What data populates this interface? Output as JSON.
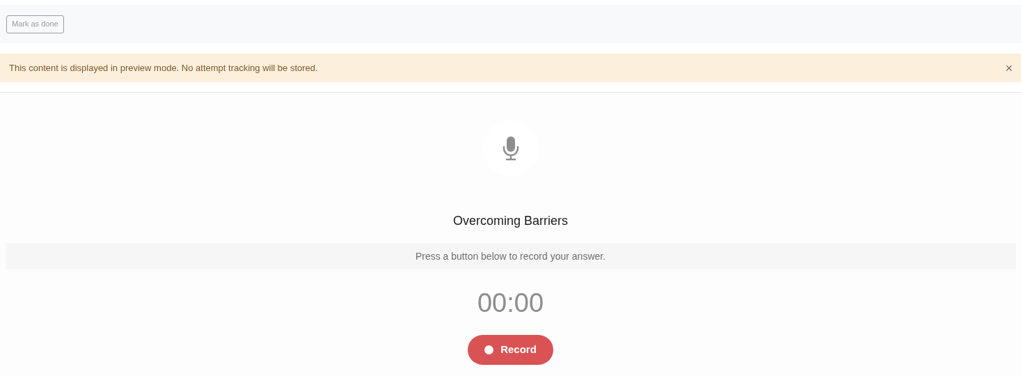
{
  "toolbar": {
    "button": "Mark as done"
  },
  "alert": {
    "message": "This content is displayed in preview mode. No attempt tracking will be stored.",
    "close": "×"
  },
  "recorder": {
    "title": "Overcoming Barriers",
    "instruction": "Press a button below to record your answer.",
    "timer": "00:00",
    "button": "Record"
  }
}
